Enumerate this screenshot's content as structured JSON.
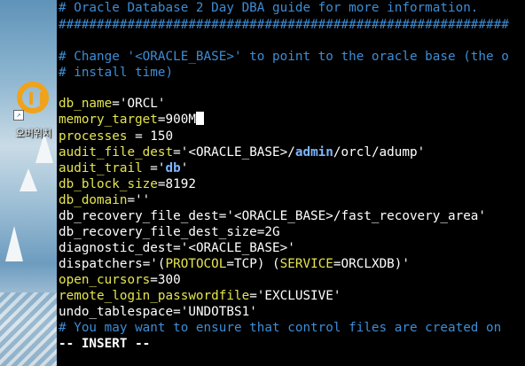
{
  "desktop": {
    "icon_label": "오버워치",
    "icon_name": "overwatch-logo-icon",
    "shortcut_arrow": "↗"
  },
  "editor": {
    "lines": [
      {
        "comment": "# Oracle Database 2 Day DBA guide for more information."
      },
      {
        "comment": "###########################################################"
      },
      {
        "comment": ""
      },
      {
        "comment": "# Change '<ORACLE_BASE>' to point to the oracle base (the o"
      },
      {
        "comment": "# install time)"
      },
      {
        "comment": ""
      },
      {
        "key": "db_name",
        "value": "='ORCL'"
      },
      {
        "key": "memory_target",
        "value": "=900M"
      },
      {
        "key": "processes",
        "value": " = 150"
      },
      {
        "key": "audit_file_dest",
        "value_pre": "='<ORACLE_BASE>/",
        "value_kw": "admin",
        "value_post": "/orcl/adump'"
      },
      {
        "key": "audit_trail",
        "value_pre": " ='",
        "value_kw": "db",
        "value_post": "'"
      },
      {
        "key": "db_block_size",
        "value": "=8192"
      },
      {
        "key": "db_domain",
        "value": "=''"
      },
      {
        "key": "db_recovery_file_dest",
        "value": "='<ORACLE_BASE>/fast_recovery_area'"
      },
      {
        "key": "db_recovery_file_dest_size",
        "value": "=2G"
      },
      {
        "key": "diagnostic_dest",
        "value": "='<ORACLE_BASE>'"
      },
      {
        "key": "dispatchers",
        "value_pre": "='(",
        "value_k1": "PROTOCOL",
        "value_mid": "=TCP) (",
        "value_k2": "SERVICE",
        "value_post": "=ORCLXDB)'"
      },
      {
        "key": "open_cursors",
        "value": "=300"
      },
      {
        "key": "remote_login_passwordfile",
        "value": "='EXCLUSIVE'"
      },
      {
        "key": "undo_tablespace",
        "value": "='UNDOTBS1'"
      },
      {
        "comment": "# You may want to ensure that control files are created on"
      }
    ],
    "mode_line": "-- INSERT --"
  },
  "colors": {
    "comment": "#3c8dd6",
    "key": "#e5e54e",
    "highlighter": "#e0e428"
  }
}
